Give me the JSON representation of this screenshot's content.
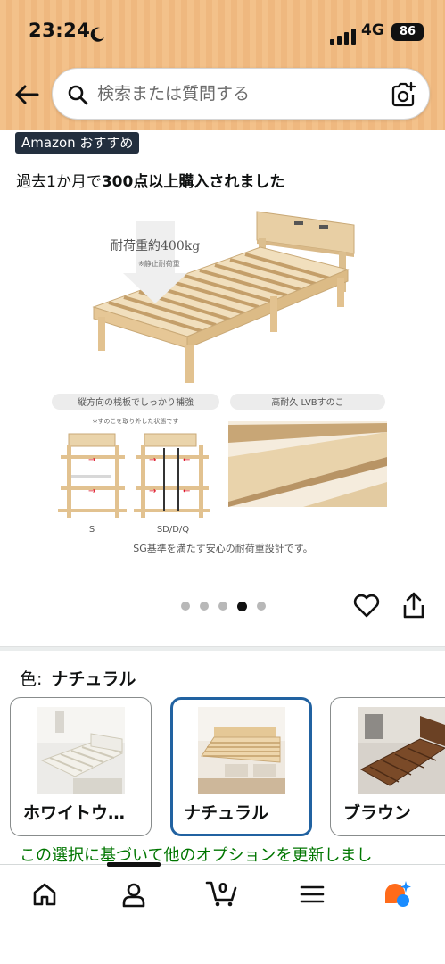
{
  "status_bar": {
    "time": "23:24",
    "network": "4G",
    "battery": "86"
  },
  "search": {
    "placeholder": "検索または質問する"
  },
  "badge": {
    "label": "Amazon おすすめ"
  },
  "purchase": {
    "prefix": "過去1か月で",
    "highlight": "300点以上購入されました"
  },
  "product_image": {
    "load_label": "耐荷重約400kg",
    "load_sub": "※静止耐荷重",
    "panel_left_title": "縦方向の桟板でしっかり補強",
    "panel_left_note": "※すのこを取り外した状態です",
    "panel_right_title": "高耐久 LVBすのこ",
    "size_small": "S",
    "size_large": "SD/D/Q",
    "footer": "SG基準を満たす安心の耐荷重設計です。"
  },
  "carousel": {
    "total": 5,
    "active_index": 3
  },
  "color": {
    "label": "色:",
    "selected": "ナチュラル",
    "options": [
      {
        "label": "ホワイトウ…"
      },
      {
        "label": "ナチュラル"
      },
      {
        "label": "ブラウン"
      }
    ],
    "update_note": "この選択に基づいて他のオプションを更新しまし"
  },
  "nav": {
    "cart_count": "0"
  },
  "colors": {
    "accent_blue": "#2162a1",
    "header_orange": "#f3c18a",
    "green_note": "#007600",
    "badge_bg": "#232f3e"
  }
}
